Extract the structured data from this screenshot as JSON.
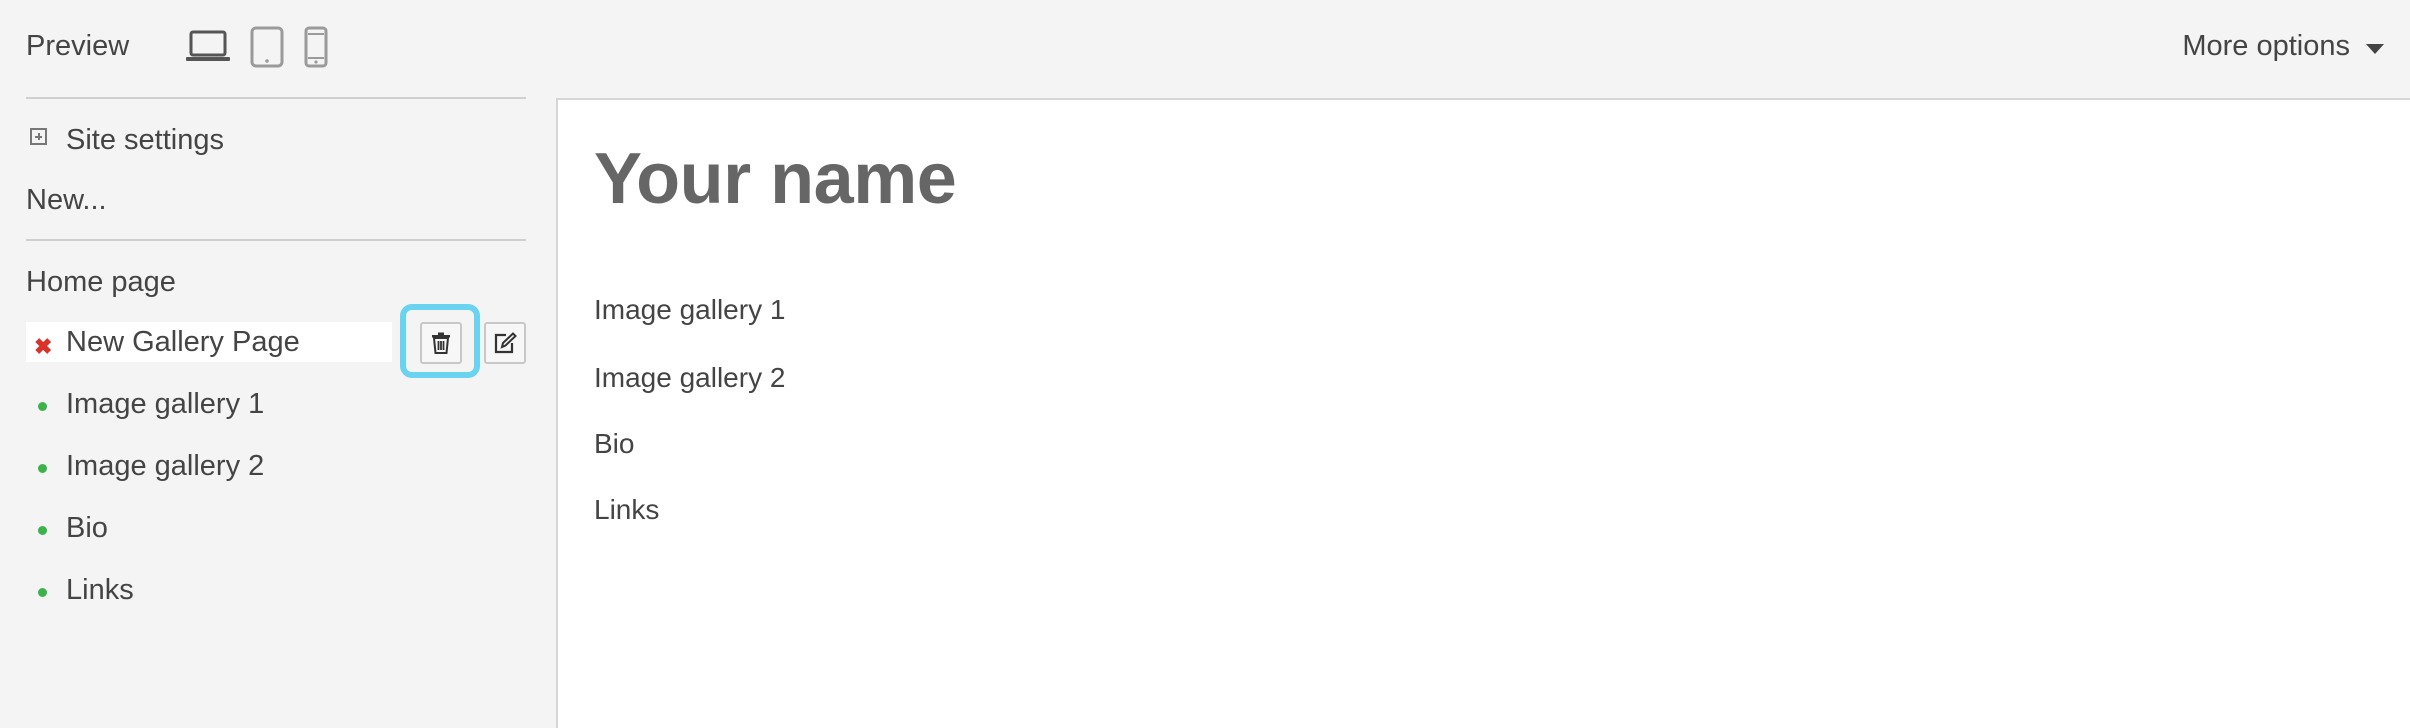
{
  "topbar": {
    "preview_label": "Preview",
    "devices": [
      "laptop-icon",
      "tablet-icon",
      "phone-icon"
    ],
    "more_options_label": "More options"
  },
  "sidebar": {
    "site_settings_label": "Site settings",
    "new_label": "New...",
    "home_page_label": "Home page",
    "active_page_label": "New Gallery Page",
    "pages": [
      "Image gallery 1",
      "Image gallery 2",
      "Bio",
      "Links"
    ],
    "colors": {
      "published_dot": "#3cb34a",
      "delete_mark": "#d9322b",
      "highlight": "#6ad3ef"
    }
  },
  "preview": {
    "site_title": "Your name",
    "nav_links": [
      "Image gallery 1",
      "Image gallery 2",
      "Bio",
      "Links"
    ]
  }
}
